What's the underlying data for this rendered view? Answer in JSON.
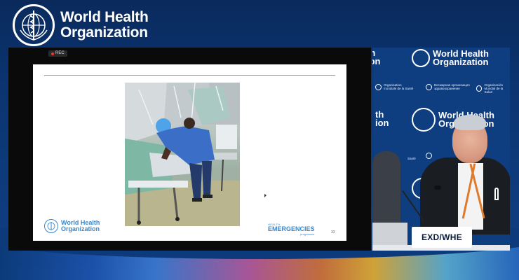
{
  "header": {
    "logo_line1": "World Health",
    "logo_line2": "Organization"
  },
  "screen_share": {
    "rec_label": "REC",
    "slide": {
      "logo_line1": "World Health",
      "logo_line2": "Organization",
      "programme_small": "HEALTH",
      "programme_big": "EMERGENCIES",
      "programme_sub": "programme",
      "page_number": "33"
    }
  },
  "speaker_view": {
    "backdrop": {
      "logo_line1": "World Health",
      "logo_line2": "Organization",
      "small_fr_line1": "Organisation",
      "small_fr_line2": "mondiale de la Santé",
      "small_ru_line1": "Всемирная организация",
      "small_ru_line2": "здравоохранения",
      "small_fr_b_line1": "Organización",
      "small_fr_b_line2": "Mundial de la Salud",
      "small_word": "Santé"
    },
    "nameplate": "EXD/WHE"
  },
  "colors": {
    "brand_blue": "#0d3a7a",
    "slide_accent": "#3d86c6",
    "rec_red": "#ee3333"
  }
}
